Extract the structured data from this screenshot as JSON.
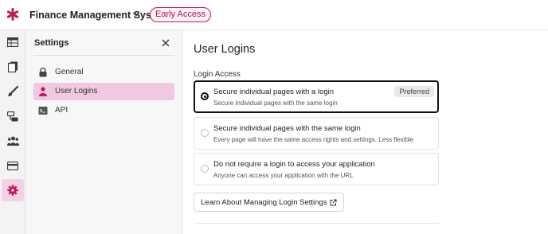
{
  "app": {
    "title": "Finance Management System",
    "badge": "Early Access",
    "brand_color": "#c2185b"
  },
  "rail": {
    "icons": [
      "table-icon",
      "pages-icon",
      "brush-icon",
      "workflow-icon",
      "users-icon",
      "card-icon",
      "settings-icon"
    ],
    "active": "settings-icon"
  },
  "panel": {
    "title": "Settings",
    "items": [
      {
        "label": "General",
        "icon": "lock-icon"
      },
      {
        "label": "User Logins",
        "icon": "user-icon"
      },
      {
        "label": "API",
        "icon": "terminal-icon"
      }
    ],
    "active_index": 1
  },
  "main": {
    "title": "User Logins",
    "section_label": "Login Access",
    "options": [
      {
        "title": "Secure individual pages with a login",
        "desc": "Secure individual pages with the same login",
        "badge": "Preferred",
        "selected": true
      },
      {
        "title": "Secure individual pages with the same login",
        "desc": "Every page will have the same access rights and settings. Less flexible",
        "selected": false
      },
      {
        "title": "Do not require a login to access your application",
        "desc": "Anyone can access your application with the URL",
        "selected": false
      }
    ],
    "learn_button": "Learn About Managing Login Settings"
  }
}
